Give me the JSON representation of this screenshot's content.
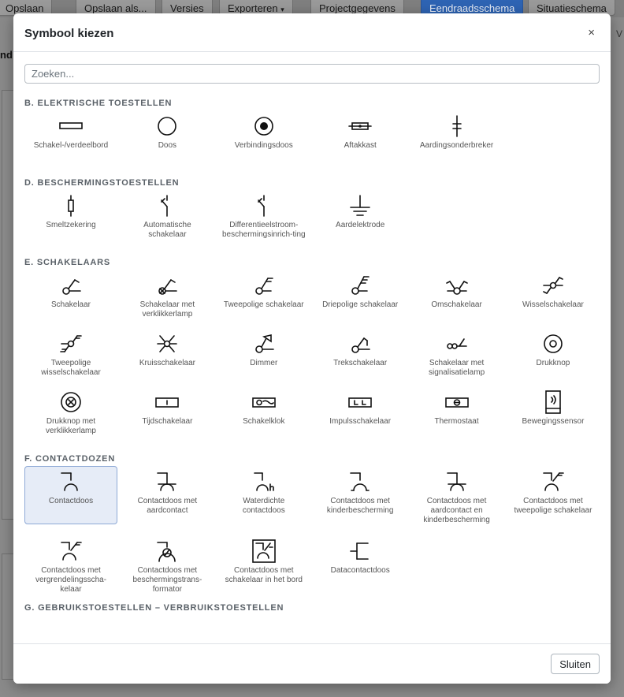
{
  "background": {
    "toolbar": [
      "Opslaan",
      "Opslaan als...",
      "Versies",
      "Exporteren",
      "Projectgegevens",
      "Eendraadsschema",
      "Situatieschema"
    ],
    "exporteren_caret": "▾",
    "side_label": "nd",
    "right_label": "V"
  },
  "modal": {
    "title": "Symbool kiezen",
    "close_glyph": "×",
    "search_placeholder": "Zoeken...",
    "footer_button": "Sluiten",
    "sections": [
      {
        "title": "B. ELEKTRISCHE TOESTELLEN",
        "items": [
          {
            "label": "Schakel-/verdeelbord",
            "icon": "distribution-board-icon"
          },
          {
            "label": "Doos",
            "icon": "box-icon"
          },
          {
            "label": "Verbindingsdoos",
            "icon": "junction-box-icon"
          },
          {
            "label": "Aftakkast",
            "icon": "branch-box-icon"
          },
          {
            "label": "Aardingsonderbreker",
            "icon": "earth-disconnector-icon"
          }
        ]
      },
      {
        "title": "D. BESCHERMINGSTOESTELLEN",
        "items": [
          {
            "label": "Smeltzekering",
            "icon": "fuse-icon"
          },
          {
            "label": "Automatische schakelaar",
            "icon": "circuit-breaker-icon"
          },
          {
            "label": "Differentieelstroom-beschermingsinrich-ting",
            "icon": "rcd-icon"
          },
          {
            "label": "Aardelektrode",
            "icon": "earth-electrode-icon"
          }
        ]
      },
      {
        "title": "E. SCHAKELAARS",
        "items": [
          {
            "label": "Schakelaar",
            "icon": "switch-icon"
          },
          {
            "label": "Schakelaar met verklikkerlamp",
            "icon": "switch-pilot-lamp-icon"
          },
          {
            "label": "Tweepolige schakelaar",
            "icon": "double-pole-switch-icon"
          },
          {
            "label": "Driepolige schakelaar",
            "icon": "triple-pole-switch-icon"
          },
          {
            "label": "Omschakelaar",
            "icon": "changeover-switch-icon"
          },
          {
            "label": "Wisselschakelaar",
            "icon": "two-way-switch-icon"
          },
          {
            "label": "Tweepolige wisselschakelaar",
            "icon": "double-pole-two-way-switch-icon"
          },
          {
            "label": "Kruisschakelaar",
            "icon": "cross-switch-icon"
          },
          {
            "label": "Dimmer",
            "icon": "dimmer-icon"
          },
          {
            "label": "Trekschakelaar",
            "icon": "pull-switch-icon"
          },
          {
            "label": "Schakelaar met signalisatielamp",
            "icon": "switch-signal-lamp-icon"
          },
          {
            "label": "Drukknop",
            "icon": "push-button-icon"
          },
          {
            "label": "Drukknop met verklikkerlamp",
            "icon": "push-button-lamp-icon"
          },
          {
            "label": "Tijdschakelaar",
            "icon": "timer-switch-icon"
          },
          {
            "label": "Schakelklok",
            "icon": "time-clock-icon"
          },
          {
            "label": "Impulsschakelaar",
            "icon": "impulse-switch-icon"
          },
          {
            "label": "Thermostaat",
            "icon": "thermostat-icon"
          },
          {
            "label": "Bewegingssensor",
            "icon": "motion-sensor-icon"
          }
        ]
      },
      {
        "title": "F. CONTACTDOZEN",
        "items": [
          {
            "label": "Contactdoos",
            "icon": "socket-icon",
            "selected": true
          },
          {
            "label": "Contactdoos met aardcontact",
            "icon": "socket-earth-icon"
          },
          {
            "label": "Waterdichte contactdoos",
            "icon": "socket-waterproof-icon"
          },
          {
            "label": "Contactdoos met kinderbescherming",
            "icon": "socket-child-protection-icon"
          },
          {
            "label": "Contactdoos met aardcontact en kinderbescherming",
            "icon": "socket-earth-child-icon"
          },
          {
            "label": "Contactdoos met tweepolige schakelaar",
            "icon": "socket-double-switch-icon"
          },
          {
            "label": "Contactdoos met vergrendelingsscha-kelaar",
            "icon": "socket-interlock-icon"
          },
          {
            "label": "Contactdoos met beschermingstrans-formator",
            "icon": "socket-transformer-icon"
          },
          {
            "label": "Contactdoos met schakelaar in het bord",
            "icon": "socket-board-switch-icon"
          },
          {
            "label": "Datacontactdoos",
            "icon": "data-socket-icon"
          }
        ]
      },
      {
        "title": "G. GEBRUIKSTOESTELLEN – VERBRUIKSTOESTELLEN",
        "items": []
      }
    ]
  }
}
